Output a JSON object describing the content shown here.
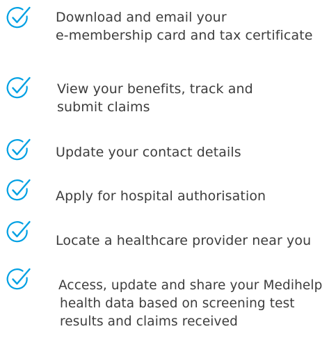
{
  "accent_color": "#00a0e3",
  "icon": "check-circle-icon",
  "features": [
    {
      "lines": [
        "Download and email your",
        "e-membership card and tax certificate"
      ]
    },
    {
      "lines": [
        "View your benefits, track and",
        "submit claims"
      ]
    },
    {
      "lines": [
        "Update your contact details"
      ]
    },
    {
      "lines": [
        "Apply for hospital authorisation"
      ]
    },
    {
      "lines": [
        "Locate a healthcare provider near you"
      ]
    },
    {
      "lines": [
        "Access, update and share your Medihelp",
        "health data based on screening test",
        "results and claims received"
      ]
    }
  ]
}
